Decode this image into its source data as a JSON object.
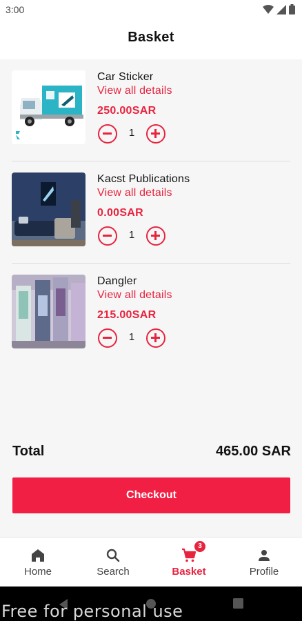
{
  "status_bar": {
    "time": "3:00"
  },
  "header": {
    "title": "Basket"
  },
  "items": [
    {
      "name": "Car Sticker",
      "details_link": "View all details",
      "price": "250.00SAR",
      "quantity": "1"
    },
    {
      "name": "Kacst Publications",
      "details_link": "View all details",
      "price": "0.00SAR",
      "quantity": "1"
    },
    {
      "name": "Dangler",
      "details_link": "View all details",
      "price": "215.00SAR",
      "quantity": "1"
    }
  ],
  "summary": {
    "total_label": "Total",
    "total_value": "465.00 SAR"
  },
  "checkout": {
    "label": "Checkout"
  },
  "bottom_nav": {
    "items": [
      {
        "label": "Home",
        "icon": "home-icon"
      },
      {
        "label": "Search",
        "icon": "search-icon"
      },
      {
        "label": "Basket",
        "icon": "cart-icon",
        "badge": "3",
        "active": true
      },
      {
        "label": "Profile",
        "icon": "person-icon"
      }
    ]
  },
  "watermark": "Free for personal use",
  "colors": {
    "accent": "#e8233e",
    "checkout": "#f21f44"
  }
}
